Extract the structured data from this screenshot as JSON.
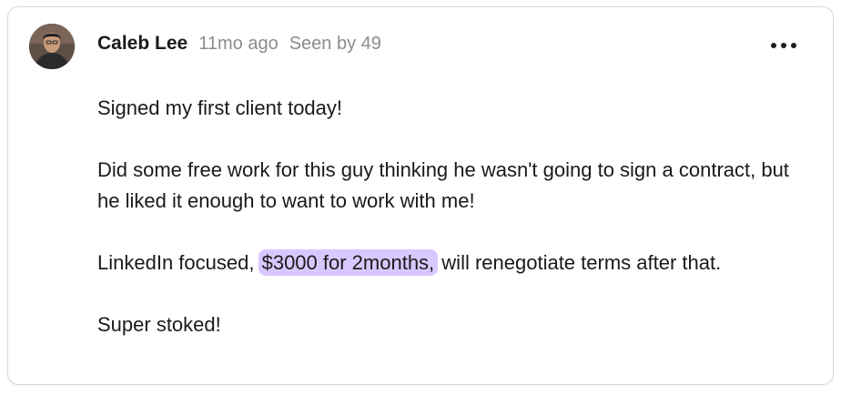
{
  "post": {
    "author": "Caleb Lee",
    "time_ago": "11mo ago",
    "seen_by": "Seen by 49",
    "paragraphs": {
      "p1": "Signed my first client today!",
      "p2": "Did some free work for this guy thinking he wasn't going to sign a contract, but he liked it enough to want to work with me!",
      "p3_before": "LinkedIn focused,",
      "p3_highlight": "$3000 for 2months,",
      "p3_after": "will renegotiate terms after that.",
      "p4": "Super stoked!"
    }
  },
  "colors": {
    "highlight": "#d9c8ff",
    "meta_text": "#8c8c8c",
    "body_text": "#1a1a1a"
  },
  "icons": {
    "menu": "more-horizontal-icon",
    "avatar": "user-avatar-photo"
  }
}
